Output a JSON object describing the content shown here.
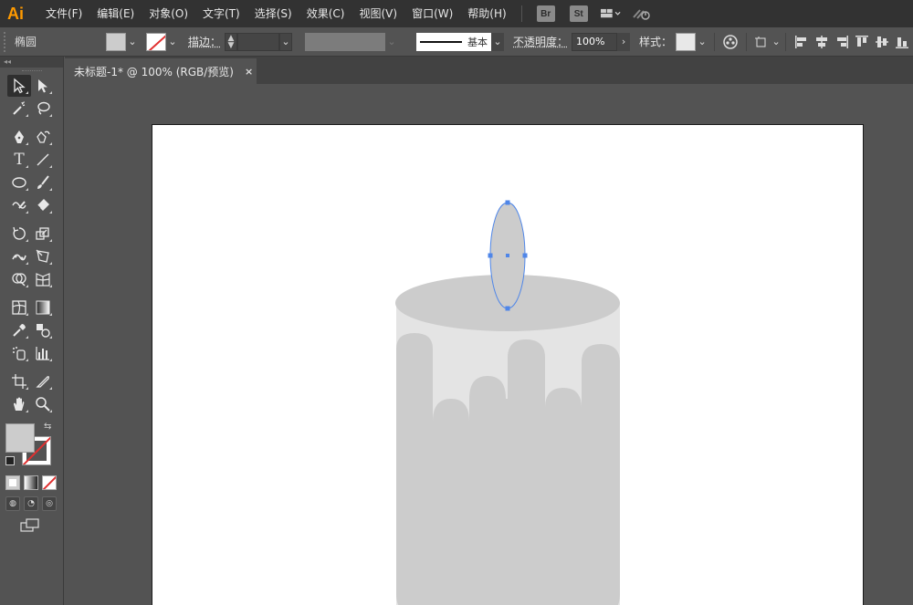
{
  "app": {
    "logo": "Ai"
  },
  "menu": {
    "items": [
      "文件(F)",
      "编辑(E)",
      "对象(O)",
      "文字(T)",
      "选择(S)",
      "效果(C)",
      "视图(V)",
      "窗口(W)",
      "帮助(H)"
    ],
    "bridge_badge": "Br",
    "stock_badge": "St"
  },
  "control": {
    "object_type": "椭圆",
    "stroke_label": "描边：",
    "stroke_profile": "基本",
    "opacity_label": "不透明度：",
    "opacity_value": "100%",
    "style_label": "样式：",
    "fill_color": "#cccccc"
  },
  "document": {
    "tab_title": "未标题-1* @ 100% (RGB/预览)",
    "close_glyph": "×"
  },
  "tools": [
    [
      "selection-tool",
      "direct-selection-tool"
    ],
    [
      "magic-wand-tool",
      "lasso-tool"
    ],
    [
      "pen-tool",
      "curvature-tool"
    ],
    [
      "type-tool",
      "line-segment-tool"
    ],
    [
      "ellipse-tool",
      "paintbrush-tool"
    ],
    [
      "shaper-tool",
      "eraser-tool"
    ],
    [
      "rotate-tool",
      "scale-tool"
    ],
    [
      "puppet-warp-tool",
      "free-transform-tool"
    ],
    [
      "shape-builder-tool",
      "perspective-grid-tool"
    ],
    [
      "mesh-tool",
      "gradient-tool"
    ],
    [
      "eyedropper-tool",
      "blend-tool"
    ],
    [
      "symbol-sprayer-tool",
      "column-graph-tool"
    ],
    [
      "artboard-tool",
      "slice-tool"
    ],
    [
      "hand-tool",
      "zoom-tool"
    ]
  ],
  "colors": {
    "selection_blue": "#4f86e8",
    "candle_light": "#e4e4e4",
    "candle_dark": "#cccccc",
    "logo_orange": "#ff9a00"
  }
}
